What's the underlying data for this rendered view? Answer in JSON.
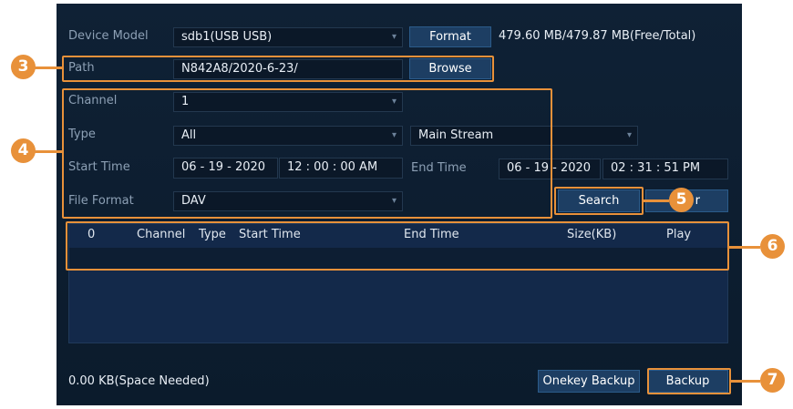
{
  "device_model": {
    "label": "Device Model",
    "value": "sdb1(USB USB)",
    "format_label": "Format",
    "capacity": "479.60 MB/479.87 MB(Free/Total)"
  },
  "path": {
    "label": "Path",
    "value": "N842A8/2020-6-23/",
    "browse_label": "Browse"
  },
  "channel": {
    "label": "Channel",
    "value": "1"
  },
  "type": {
    "label": "Type",
    "value": "All",
    "stream": "Main Stream"
  },
  "start_time": {
    "label": "Start Time",
    "date": "06 - 19 - 2020",
    "time": "12 : 00 : 00 AM"
  },
  "end_time": {
    "label": "End Time",
    "date": "06 - 19 - 2020",
    "time": "02 : 31 : 51 PM"
  },
  "file_format": {
    "label": "File Format",
    "value": "DAV"
  },
  "search_label": "Search",
  "clear_partial": "r",
  "table": {
    "columns": [
      "0",
      "Channel",
      "Type",
      "Start Time",
      "End Time",
      "Size(KB)",
      "Play"
    ]
  },
  "space_needed": "0.00 KB(Space Needed)",
  "onekey_label": "Onekey Backup",
  "backup_label": "Backup",
  "callouts": [
    "3",
    "4",
    "5",
    "6",
    "7"
  ],
  "colors": {
    "accent": "#e8913a",
    "panel": "#0f2135",
    "button": "#1d3e63"
  }
}
